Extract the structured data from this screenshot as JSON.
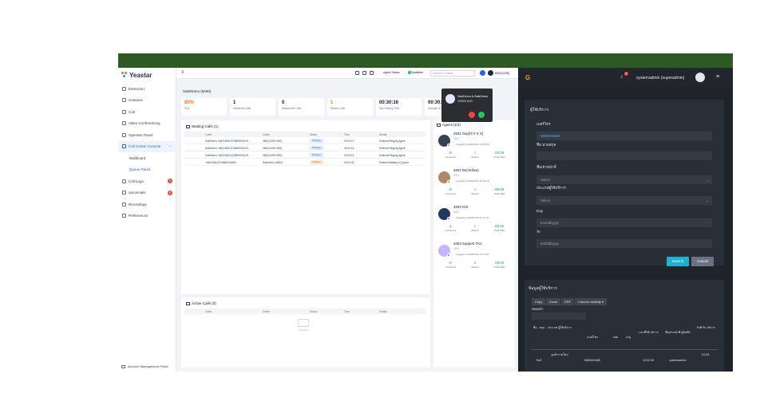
{
  "yeastar": {
    "logo": "Yeastar",
    "nav": [
      {
        "label": "Extension"
      },
      {
        "label": "Contacts"
      },
      {
        "label": "Call"
      },
      {
        "label": "Video Conferencing"
      },
      {
        "label": "Operator Panel"
      },
      {
        "label": "Call Center Console",
        "active": true
      },
      {
        "label": "Wallboard",
        "sub": true
      },
      {
        "label": "Queue Panel",
        "sub": true,
        "active": true
      },
      {
        "label": "Call Logs",
        "badge": "9"
      },
      {
        "label": "Voicemails",
        "badge": "8"
      },
      {
        "label": "Recordings"
      },
      {
        "label": "Preferences"
      }
    ],
    "amp": "Account Management Portal",
    "topbar": {
      "agent_status": "Agent Status",
      "availability": "Available",
      "number_placeholder": "Number or Name",
      "extension": "6000(1035)"
    },
    "queue_select": "SaleDemo (6400)",
    "stats": [
      {
        "value": "80%",
        "label": "SLA",
        "accent": true
      },
      {
        "value": "1",
        "label": "Answered Calls"
      },
      {
        "value": "0",
        "label": "Abandoned Calls"
      },
      {
        "value": "1",
        "label": "Missed Calls",
        "accent": true
      },
      {
        "value": "00:30:16",
        "label": "Max Waiting Time"
      },
      {
        "value": "00:30:1",
        "label": "Average W"
      }
    ],
    "waiting": {
      "title": "Waiting Calls (1)",
      "columns": [
        "Caller",
        "Callee",
        "Status",
        "Time",
        "Details"
      ],
      "rows": [
        {
          "caller": "SaleDemo <662165412C0865001619...",
          "callee": "4662(1035 0490)",
          "status": "Ringing",
          "time": "00:00:10",
          "details": "External:Ringing Agent"
        },
        {
          "caller": "SaleDemo <662165412C0865001619...",
          "callee": "4662(1035 0490)",
          "status": "Ringing",
          "time": "00:00:16",
          "details": "External:Ringing Agent"
        },
        {
          "caller": "SaleDemo <662165412C0865001619...",
          "callee": "4662(1035 0490)",
          "status": "Ringing",
          "time": "00:00:15",
          "details": "External:Ringing Agent"
        },
        {
          "caller": "<662165412C0865001669>",
          "callee": "SaleDemo (6400)",
          "status": "Waiting",
          "time": "00:00:30",
          "details": "External:Waiting In Queue"
        }
      ]
    },
    "active": {
      "title": "Active Calls (0)",
      "columns": [
        "Caller",
        "Callee",
        "Status",
        "Time",
        "Details"
      ],
      "nodata": "No Data"
    },
    "agents_title": "Agent (4/4)",
    "agents": [
      {
        "name": "3531 Sup(ICY X X)",
        "ext": "3531",
        "logged": "Logged in 2023/03/12 15:29:16",
        "answered": "0",
        "missed": "1",
        "talk": "00:00",
        "status_color": "#22c55e"
      },
      {
        "name": "4001 Bo(Yellow)",
        "ext": "4001",
        "logged": "Logged in 2023/03/12 15:30:15",
        "answered": "0",
        "missed": "1",
        "talk": "00:00",
        "status_color": "#22c55e"
      },
      {
        "name": "4002 IOS",
        "ext": "4002",
        "logged": "Logged in 2023/03/12 11:17:41",
        "answered": "1",
        "missed": "1",
        "talk": "00:32",
        "status_color": "#ef4444"
      },
      {
        "name": "4003 Support TK2",
        "ext": "4003",
        "logged": "Logged in 2023/03/12 11:11:24",
        "answered": "0",
        "missed": "0",
        "talk": "00:00",
        "status_color": "#22c55e"
      }
    ],
    "agent_metric_labels": {
      "answered": "Answered",
      "missed": "Missed",
      "talk": "Total Talks"
    },
    "incoming": {
      "name": "SaleDemo A-SaleDemo",
      "number": "0805001669"
    }
  },
  "crm": {
    "logo": "G",
    "notification_count": "2",
    "user": "systemadmin (superadmin)",
    "form_title": "ผู้ใช้บริการ",
    "fields": {
      "phone_label": "เบอร์โทร",
      "phone_value": "0805001669",
      "name_label": "ชื่อ นามสกุล",
      "type_label": "ชื่อเจ้าหน้าที่",
      "type_value": "Select",
      "service_label": "ประเภทผู้ใช้บริการ",
      "service_value": "Select",
      "day_label": "Day",
      "day_value": "mm/dd/yyyy",
      "to_label": "To",
      "to_value": "mm/dd/yyyy"
    },
    "search_btn": "Search",
    "cancel_btn": "Cancel",
    "data_title": "ข้อมูลผู้ใช้บริการ",
    "export_btns": [
      "Copy",
      "Excel",
      "PDF",
      "Column visibility ▾"
    ],
    "search_label": "Search:",
    "table_headers": [
      "ชื่อ - สกุล",
      "ประเภท ผู้ใช้บริการ",
      "เบอร์โทร",
      "เพศ",
      "อายุ",
      "เวลาที่ใช้ บริการ",
      "ชื่อเจ้าหน้าที่ ผู้บันทึก",
      "วันที่ รับ บริการ"
    ],
    "table_row": [
      "กัลป์",
      "ลูกค้ารายใหม่",
      "0805001669",
      "",
      "",
      "13:32:35",
      "systemadmin",
      "24-02-"
    ]
  }
}
